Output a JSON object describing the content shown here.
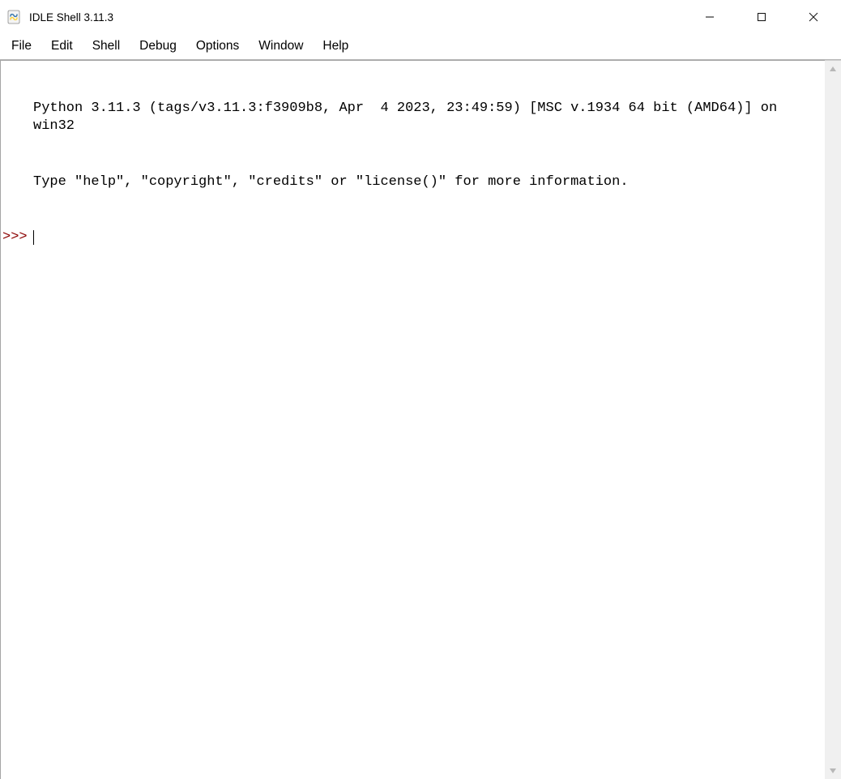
{
  "window": {
    "title": "IDLE Shell 3.11.3"
  },
  "menubar": {
    "items": [
      "File",
      "Edit",
      "Shell",
      "Debug",
      "Options",
      "Window",
      "Help"
    ]
  },
  "shell": {
    "banner_line1": "Python 3.11.3 (tags/v3.11.3:f3909b8, Apr  4 2023, 23:49:59) [MSC v.1934 64 bit (AMD64)] on win32",
    "banner_line2": "Type \"help\", \"copyright\", \"credits\" or \"license()\" for more information.",
    "prompt": ">>>"
  }
}
